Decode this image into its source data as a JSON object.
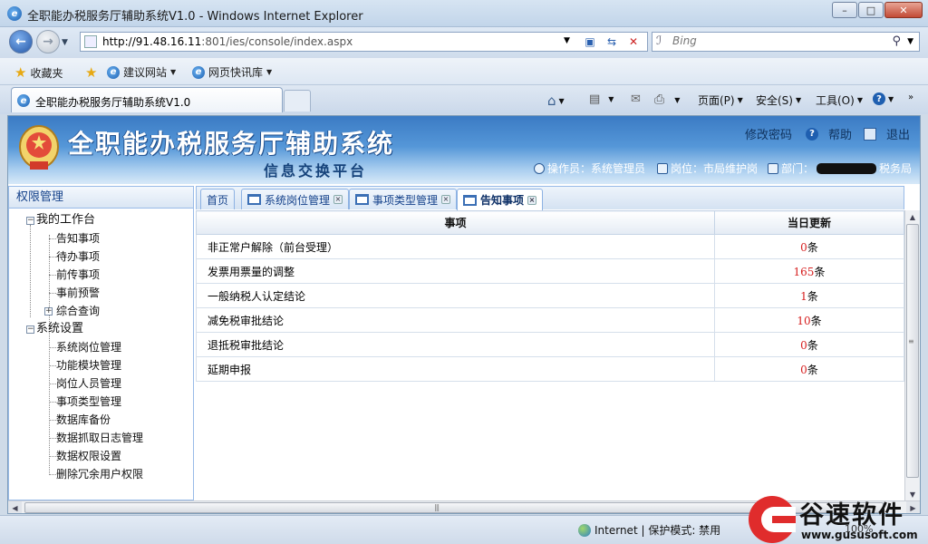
{
  "window": {
    "title": "全职能办税服务厅辅助系统V1.0 - Windows Internet Explorer",
    "minimize": "–",
    "maximize": "□",
    "close": "✕"
  },
  "address": {
    "url_host": "http://91.48.16.11",
    "url_path": ":801/ies/console/index.aspx",
    "search_placeholder": "Bing"
  },
  "favorites": {
    "favorites_label": "收藏夹",
    "items": [
      "建议网站",
      "网页快讯库"
    ]
  },
  "browser_tab": {
    "title": "全职能办税服务厅辅助系统V1.0"
  },
  "command_bar": {
    "page": "页面(P)",
    "safety": "安全(S)",
    "tools": "工具(O)"
  },
  "header": {
    "system_title": "全职能办税服务厅辅助系统",
    "subtitle": "信息交换平台",
    "change_password": "修改密码",
    "help": "帮助",
    "exit": "退出",
    "operator": "操作员：系统管理员",
    "post": "岗位：市局维护岗",
    "department_prefix": "部门：",
    "department_suffix": "税务局"
  },
  "sidebar": {
    "title": "权限管理",
    "groups": [
      {
        "label": "我的工作台",
        "items": [
          "告知事项",
          "待办事项",
          "前传事项",
          "事前预警",
          "综合查询"
        ]
      },
      {
        "label": "系统设置",
        "items": [
          "系统岗位管理",
          "功能模块管理",
          "岗位人员管理",
          "事项类型管理",
          "数据库备份",
          "数据抓取日志管理",
          "数据权限设置",
          "删除冗余用户权限"
        ]
      }
    ]
  },
  "content_tabs": [
    "首页",
    "系统岗位管理",
    "事项类型管理",
    "告知事项"
  ],
  "table": {
    "headers": [
      "事项",
      "当日更新"
    ],
    "unit": "条",
    "rows": [
      {
        "name": "非正常户解除（前台受理）",
        "count": "0"
      },
      {
        "name": "发票用票量的调整",
        "count": "165"
      },
      {
        "name": "一般纳税人认定结论",
        "count": "1"
      },
      {
        "name": "减免税审批结论",
        "count": "10"
      },
      {
        "name": "退抵税审批结论",
        "count": "0"
      },
      {
        "name": "延期申报",
        "count": "0"
      }
    ]
  },
  "status": {
    "zone": "Internet | 保护模式: 禁用",
    "zoom": "100%"
  },
  "watermark": {
    "brand": "谷速软件",
    "site": "www.gususoft.com"
  }
}
